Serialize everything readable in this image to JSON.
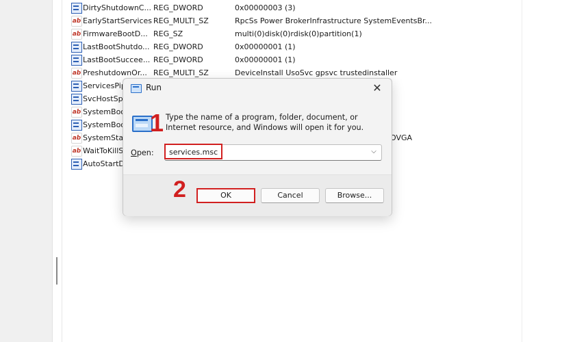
{
  "registry": {
    "rows": [
      {
        "name": "DirtyShutdownC...",
        "type": "REG_DWORD",
        "data": "0x00000003 (3)",
        "icon": "bin-value-icon"
      },
      {
        "name": "EarlyStartServices",
        "type": "REG_MULTI_SZ",
        "data": "RpcSs Power BrokerInfrastructure SystemEventsBr...",
        "icon": "string-value-icon"
      },
      {
        "name": "FirmwareBootD...",
        "type": "REG_SZ",
        "data": "multi(0)disk(0)rdisk(0)partition(1)",
        "icon": "string-value-icon"
      },
      {
        "name": "LastBootShutdo...",
        "type": "REG_DWORD",
        "data": "0x00000001 (1)",
        "icon": "bin-value-icon"
      },
      {
        "name": "LastBootSuccee...",
        "type": "REG_DWORD",
        "data": "0x00000001 (1)",
        "icon": "bin-value-icon"
      },
      {
        "name": "PreshutdownOr...",
        "type": "REG_MULTI_SZ",
        "data": "DeviceInstall UsoSvc gpsvc trustedinstaller",
        "icon": "string-value-icon"
      },
      {
        "name": "ServicesPip",
        "type": "",
        "data": "",
        "icon": "bin-value-icon"
      },
      {
        "name": "SvcHostSpl",
        "type": "",
        "data": "",
        "icon": "bin-value-icon"
      },
      {
        "name": "SystemBoo",
        "type": "",
        "data": "",
        "icon": "string-value-icon"
      },
      {
        "name": "SystemBoo",
        "type": "",
        "data": "",
        "icon": "bin-value-icon"
      },
      {
        "name": "SystemStar",
        "type": "",
        "data": "OVGA",
        "icon": "string-value-icon"
      },
      {
        "name": "WaitToKillS",
        "type": "",
        "data": "",
        "icon": "string-value-icon"
      },
      {
        "name": "AutoStartD",
        "type": "",
        "data": "",
        "icon": "bin-value-icon"
      }
    ]
  },
  "run_dialog": {
    "title": "Run",
    "close_glyph": "✕",
    "description": "Type the name of a program, folder, document, or Internet resource, and Windows will open it for you.",
    "open_label_first": "O",
    "open_label_rest": "pen:",
    "open_value": "services.msc",
    "chevron_glyph": "⌵",
    "buttons": {
      "ok": "OK",
      "cancel": "Cancel",
      "browse": "Browse..."
    }
  },
  "annotations": {
    "step_one": "1",
    "step_two": "2",
    "highlight_color": "#d11f1f"
  },
  "colors": {
    "accent": "#2a6fc9",
    "dialog_bg": "#f3f3f3",
    "button_row_bg": "#ebebeb"
  }
}
